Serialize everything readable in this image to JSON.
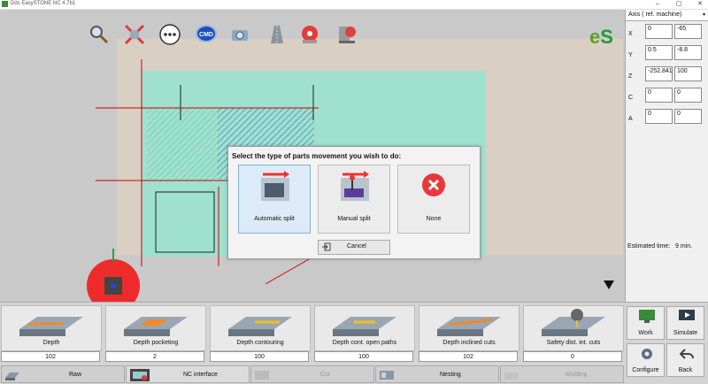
{
  "window": {
    "title": "Dds EasySTONE NC 4.7b1",
    "min_glyph": "–",
    "max_glyph": "▢",
    "close_glyph": "✕"
  },
  "toolbar": {
    "cmd_label": "CMD",
    "icons": [
      "zoom-icon",
      "fit-view-icon",
      "more-icon",
      "cmd-icon",
      "camera-icon",
      "slab-icon",
      "blade-icon",
      "machine-icon"
    ]
  },
  "logo": {
    "text_e": "e",
    "text_s": "S",
    "color_e": "#5aa02c",
    "color_s": "#1e9b3a"
  },
  "dialog": {
    "title": "Select the type of parts movement you wish to do:",
    "options": [
      {
        "label": "Automatic split"
      },
      {
        "label": "Manual split"
      },
      {
        "label": "None"
      }
    ],
    "cancel_label": "Cancel"
  },
  "axis_panel": {
    "header": "Axis ( ref. machine)",
    "rows": [
      {
        "axis": "X",
        "v1": "0",
        "v2": "-65"
      },
      {
        "axis": "Y",
        "v1": "0.5",
        "v2": "-8.8"
      },
      {
        "axis": "Z",
        "v1": "-252.841",
        "v2": "100"
      },
      {
        "axis": "C",
        "v1": "0",
        "v2": "0"
      },
      {
        "axis": "A",
        "v1": "0",
        "v2": "0"
      }
    ],
    "estimated_label": "Estimated time:",
    "estimated_value": "9 min."
  },
  "tools": [
    {
      "label": "Depth",
      "value": "102"
    },
    {
      "label": "Depth pocketing",
      "value": "2"
    },
    {
      "label": "Depth contouring",
      "value": "100"
    },
    {
      "label": "Depth cont. open paths",
      "value": "100"
    },
    {
      "label": "Depth inclined cuts",
      "value": "102"
    },
    {
      "label": "Safety dist. int. cuts",
      "value": "0"
    }
  ],
  "tabs": [
    {
      "label": "Raw"
    },
    {
      "label": "NC interface"
    },
    {
      "label": "Cut"
    },
    {
      "label": "Nesting"
    },
    {
      "label": "Molding"
    }
  ],
  "side_buttons": {
    "work": "Work",
    "simulate": "Simulate",
    "configure": "Configure",
    "back": "Back"
  },
  "colors": {
    "teal": "#8fd8c3",
    "teal_dark": "#4cb8a1",
    "dialog_bg": "#f3f3f3",
    "accent_red": "#e8383d"
  }
}
